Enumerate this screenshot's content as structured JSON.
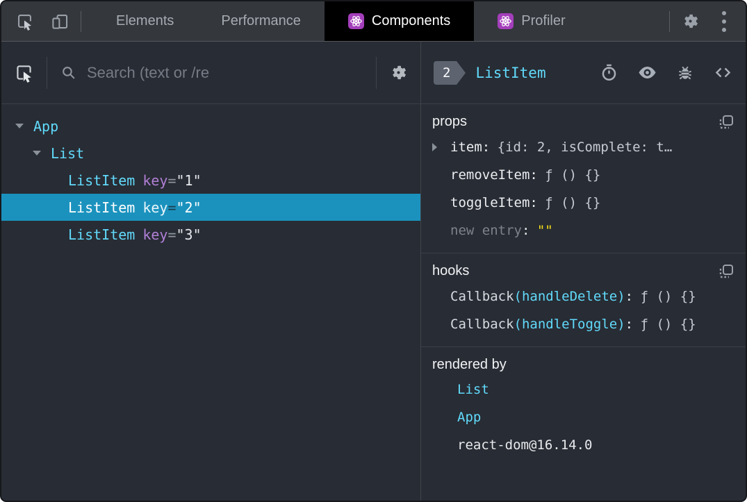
{
  "colors": {
    "panel_bg": "#282c34",
    "tabbar_bg": "#34373c",
    "active_tab_bg": "#000000",
    "selection_bg": "#1b92be",
    "component_cyan": "#61dafb",
    "key_purple": "#b07fd6",
    "editable_yellow": "#f5e01a",
    "react_icon_purple": "#a43fbb",
    "icon_gray": "#9ba1a9"
  },
  "tabbar": {
    "tabs": [
      {
        "label": "Elements",
        "active": false,
        "has_react_icon": false
      },
      {
        "label": "Performance",
        "active": false,
        "has_react_icon": false
      },
      {
        "label": "Components",
        "active": true,
        "has_react_icon": true
      },
      {
        "label": "Profiler",
        "active": false,
        "has_react_icon": true
      }
    ],
    "icons": [
      "inspect-element-icon",
      "toggle-device-toolbar-icon",
      "settings-gear-icon",
      "more-options-kebab-icon"
    ]
  },
  "left_toolbar": {
    "icons": [
      "inspect-component-icon",
      "search-icon",
      "settings-gear-icon"
    ],
    "search_placeholder": "Search (text or /re"
  },
  "tree": {
    "rows": [
      {
        "depth": 0,
        "arrow": "down",
        "name": "App",
        "selected": false
      },
      {
        "depth": 1,
        "arrow": "down",
        "name": "List",
        "selected": false
      },
      {
        "depth": 2,
        "arrow": "none",
        "name": "ListItem",
        "attr": "key",
        "eq": "=",
        "value": "\"1\"",
        "selected": false
      },
      {
        "depth": 2,
        "arrow": "none",
        "name": "ListItem",
        "attr": "key",
        "eq": "=",
        "value": "\"2\"",
        "selected": true
      },
      {
        "depth": 2,
        "arrow": "none",
        "name": "ListItem",
        "attr": "key",
        "eq": "=",
        "value": "\"3\"",
        "selected": false
      }
    ]
  },
  "inspector": {
    "badge_count": "2",
    "component_name": "ListItem",
    "header_icons": [
      "stopwatch-suspend-icon",
      "eye-inspect-dom-icon",
      "bug-log-icon",
      "view-source-code-icon"
    ],
    "props": {
      "title": "props",
      "copy_icon": "copy-icon",
      "rows": [
        {
          "name": "item:",
          "value": "{id: 2, isComplete: t…",
          "expandable": true
        },
        {
          "name": "removeItem:",
          "value": "ƒ () {}",
          "expandable": false
        },
        {
          "name": "toggleItem:",
          "value": "ƒ () {}",
          "expandable": false
        },
        {
          "name": "new entry",
          "sep": ":",
          "value": "\"\"",
          "expandable": false,
          "muted": true,
          "editable": true
        }
      ]
    },
    "hooks": {
      "title": "hooks",
      "copy_icon": "copy-icon",
      "rows": [
        {
          "prefix": "Callback",
          "fn": "(handleDelete)",
          "sep": ":",
          "value": "ƒ () {}"
        },
        {
          "prefix": "Callback",
          "fn": "(handleToggle)",
          "sep": ":",
          "value": "ƒ () {}"
        }
      ]
    },
    "rendered_by": {
      "title": "rendered by",
      "items": [
        {
          "label": "List",
          "link": true
        },
        {
          "label": "App",
          "link": true
        },
        {
          "label": "react-dom@16.14.0",
          "link": false
        }
      ]
    }
  }
}
